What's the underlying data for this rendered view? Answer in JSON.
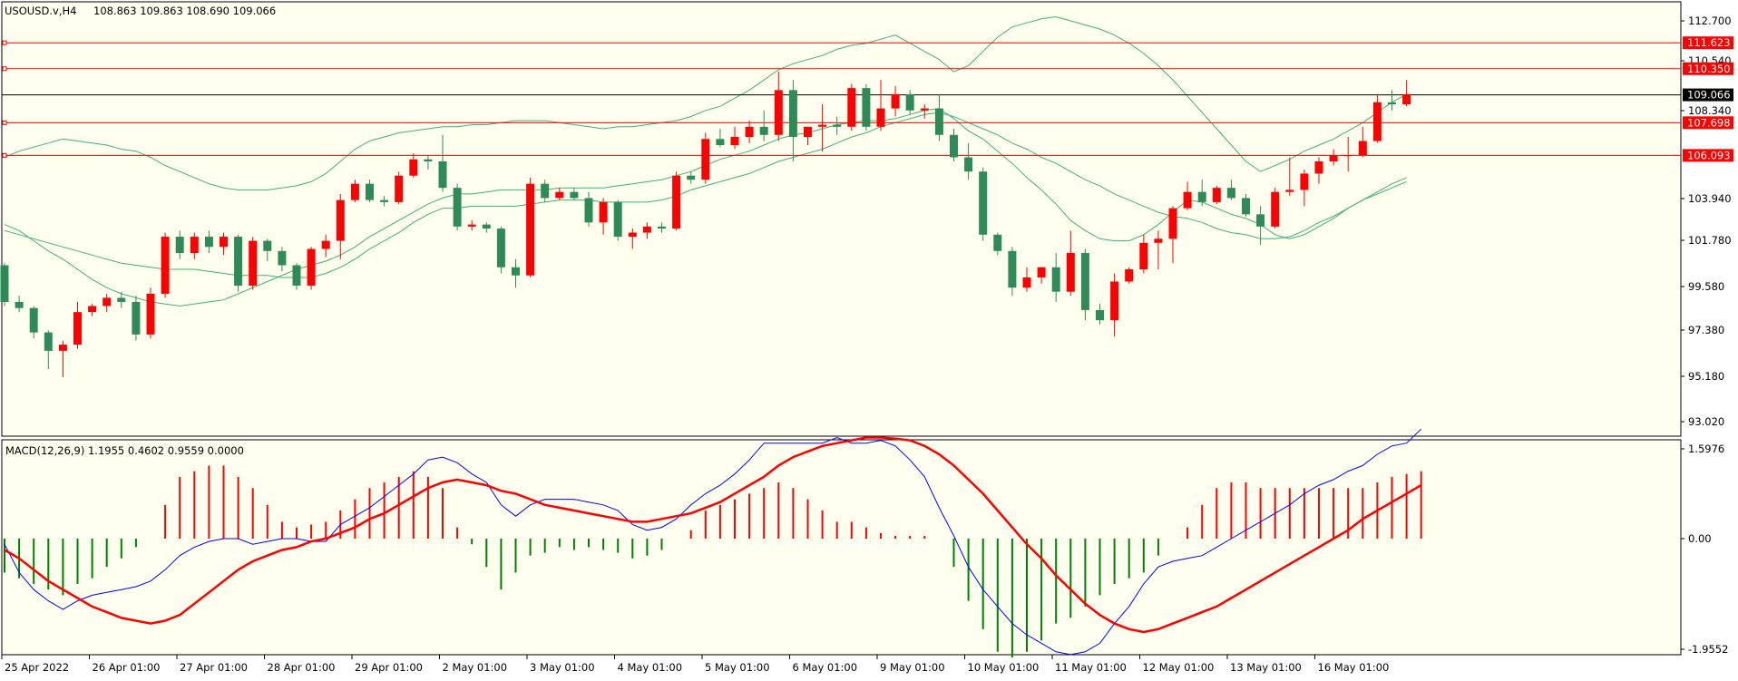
{
  "chart_data": [
    {
      "type": "candlestick",
      "header": {
        "symbol": "USOUSD.v,H4",
        "ohlc": "108.863 109.863 108.690 109.066"
      },
      "ylim": [
        92.0,
        114.0
      ],
      "y_ticks": [
        "112.700",
        "110.540",
        "108.340",
        "103.940",
        "101.780",
        "99.580",
        "97.380",
        "95.180",
        "93.020"
      ],
      "x_ticks": [
        "25 Apr 2022",
        "26 Apr 01:00",
        "27 Apr 01:00",
        "28 Apr 01:00",
        "29 Apr 01:00",
        "2 May 01:00",
        "3 May 01:00",
        "4 May 01:00",
        "5 May 01:00",
        "6 May 01:00",
        "9 May 01:00",
        "10 May 01:00",
        "11 May 01:00",
        "12 May 01:00",
        "13 May 01:00",
        "16 May 01:00"
      ],
      "horizontal_levels": [
        {
          "label": "111.623",
          "value": 111.623,
          "color": "#ff0000"
        },
        {
          "label": "110.350",
          "value": 110.35,
          "color": "#ff0000"
        },
        {
          "label": "107.698",
          "value": 107.698,
          "color": "#ff0000"
        },
        {
          "label": "106.093",
          "value": 106.093,
          "color": "#ff0000"
        }
      ],
      "current_price": {
        "label": "109.066",
        "value": 109.066
      },
      "colors": {
        "up": "#ff0000",
        "down": "#2e8b57",
        "bands": "#3cb371"
      },
      "candles": [
        [
          100.7,
          100.8,
          98.7,
          98.9
        ],
        [
          98.9,
          99.2,
          98.4,
          98.6
        ],
        [
          98.6,
          98.7,
          97.1,
          97.4
        ],
        [
          97.4,
          97.5,
          95.6,
          96.5
        ],
        [
          96.5,
          97.0,
          95.2,
          96.8
        ],
        [
          96.8,
          98.9,
          96.6,
          98.4
        ],
        [
          98.4,
          98.8,
          98.2,
          98.7
        ],
        [
          98.7,
          99.3,
          98.4,
          99.1
        ],
        [
          99.1,
          99.4,
          98.6,
          98.9
        ],
        [
          98.9,
          99.2,
          97.0,
          97.3
        ],
        [
          97.3,
          99.6,
          97.1,
          99.3
        ],
        [
          99.3,
          102.3,
          99.1,
          102.1
        ],
        [
          102.1,
          102.4,
          101.0,
          101.3
        ],
        [
          101.3,
          102.3,
          101.0,
          102.1
        ],
        [
          102.1,
          102.4,
          101.3,
          101.6
        ],
        [
          101.6,
          102.3,
          101.2,
          102.1
        ],
        [
          102.1,
          102.2,
          99.4,
          99.7
        ],
        [
          99.7,
          102.1,
          99.5,
          101.9
        ],
        [
          101.9,
          102.0,
          100.9,
          101.4
        ],
        [
          101.4,
          101.6,
          100.4,
          100.7
        ],
        [
          100.7,
          100.8,
          99.5,
          99.7
        ],
        [
          99.7,
          101.6,
          99.5,
          101.5
        ],
        [
          101.5,
          102.2,
          101.1,
          101.9
        ],
        [
          101.9,
          104.2,
          101.0,
          103.9
        ],
        [
          103.9,
          104.9,
          103.8,
          104.7
        ],
        [
          104.7,
          104.9,
          103.8,
          103.9
        ],
        [
          103.9,
          104.1,
          103.6,
          103.8
        ],
        [
          103.8,
          105.3,
          103.7,
          105.1
        ],
        [
          105.1,
          106.2,
          105.0,
          105.9
        ],
        [
          105.9,
          106.1,
          105.4,
          105.8
        ],
        [
          105.8,
          107.1,
          104.3,
          104.5
        ],
        [
          104.5,
          104.7,
          102.4,
          102.6
        ],
        [
          102.6,
          102.9,
          102.4,
          102.7
        ],
        [
          102.7,
          102.8,
          102.3,
          102.5
        ],
        [
          102.5,
          102.6,
          100.3,
          100.6
        ],
        [
          100.6,
          101.0,
          99.6,
          100.2
        ],
        [
          100.2,
          105.0,
          100.1,
          104.7
        ],
        [
          104.7,
          104.9,
          103.8,
          104.0
        ],
        [
          104.0,
          104.5,
          103.9,
          104.3
        ],
        [
          104.3,
          104.5,
          103.9,
          104.0
        ],
        [
          104.0,
          104.3,
          102.6,
          102.8
        ],
        [
          102.8,
          104.0,
          102.2,
          103.8
        ],
        [
          103.8,
          103.9,
          101.9,
          102.1
        ],
        [
          102.1,
          102.5,
          101.5,
          102.3
        ],
        [
          102.3,
          102.8,
          102.0,
          102.6
        ],
        [
          102.6,
          102.8,
          102.3,
          102.5
        ],
        [
          102.5,
          105.3,
          102.4,
          105.1
        ],
        [
          105.1,
          105.3,
          104.7,
          104.9
        ],
        [
          104.9,
          107.2,
          104.7,
          106.9
        ],
        [
          106.9,
          107.4,
          106.5,
          106.6
        ],
        [
          106.6,
          107.5,
          106.4,
          107.0
        ],
        [
          107.0,
          107.8,
          106.7,
          107.5
        ],
        [
          107.5,
          108.3,
          106.8,
          107.1
        ],
        [
          107.1,
          110.2,
          106.8,
          109.3
        ],
        [
          109.3,
          109.8,
          105.8,
          107.0
        ],
        [
          107.0,
          107.5,
          106.6,
          107.5
        ],
        [
          107.5,
          108.6,
          106.3,
          107.6
        ],
        [
          107.6,
          108.0,
          107.1,
          107.5
        ],
        [
          107.5,
          109.6,
          107.3,
          109.4
        ],
        [
          109.4,
          109.6,
          107.3,
          107.5
        ],
        [
          107.5,
          109.8,
          107.3,
          108.4
        ],
        [
          108.4,
          109.5,
          108.0,
          109.1
        ],
        [
          109.1,
          109.3,
          108.1,
          108.3
        ],
        [
          108.3,
          108.6,
          107.9,
          108.4
        ],
        [
          108.4,
          109.1,
          106.8,
          107.1
        ],
        [
          107.1,
          107.4,
          105.8,
          106.0
        ],
        [
          106.0,
          106.7,
          104.9,
          105.3
        ],
        [
          105.3,
          105.5,
          101.9,
          102.2
        ],
        [
          102.2,
          102.3,
          101.2,
          101.4
        ],
        [
          101.4,
          101.6,
          99.2,
          99.6
        ],
        [
          99.6,
          100.6,
          99.4,
          100.1
        ],
        [
          100.1,
          100.6,
          99.8,
          100.6
        ],
        [
          100.6,
          101.3,
          98.9,
          99.4
        ],
        [
          99.4,
          102.4,
          99.2,
          101.3
        ],
        [
          101.3,
          101.5,
          98.0,
          98.5
        ],
        [
          98.5,
          98.8,
          97.8,
          98.0
        ],
        [
          98.0,
          100.3,
          97.2,
          99.9
        ],
        [
          99.9,
          100.6,
          99.8,
          100.5
        ],
        [
          100.5,
          102.2,
          100.3,
          101.8
        ],
        [
          101.8,
          102.4,
          100.5,
          102.0
        ],
        [
          102.0,
          103.6,
          100.8,
          103.5
        ],
        [
          103.5,
          104.8,
          103.4,
          104.3
        ],
        [
          104.3,
          104.9,
          103.6,
          103.8
        ],
        [
          103.8,
          104.6,
          103.7,
          104.5
        ],
        [
          104.5,
          104.9,
          103.9,
          104.0
        ],
        [
          104.0,
          104.2,
          103.1,
          103.2
        ],
        [
          103.2,
          103.6,
          101.7,
          102.6
        ],
        [
          102.6,
          104.5,
          102.5,
          104.3
        ],
        [
          104.3,
          106.0,
          104.1,
          104.4
        ],
        [
          104.4,
          105.4,
          103.6,
          105.2
        ],
        [
          105.2,
          106.0,
          104.7,
          105.8
        ],
        [
          105.8,
          106.4,
          105.6,
          106.1
        ],
        [
          106.1,
          107.0,
          105.3,
          106.1
        ],
        [
          106.1,
          107.5,
          106.0,
          106.8
        ],
        [
          106.8,
          109.1,
          106.7,
          108.7
        ],
        [
          108.7,
          109.3,
          108.3,
          108.6
        ],
        [
          108.6,
          109.8,
          108.5,
          109.1
        ]
      ],
      "bollinger": {
        "middle": [
          102.4,
          102.2,
          102.0,
          101.8,
          101.6,
          101.4,
          101.2,
          101.0,
          100.8,
          100.7,
          100.6,
          100.5,
          100.5,
          100.5,
          100.4,
          100.3,
          100.2,
          100.2,
          100.2,
          100.1,
          100.1,
          100.1,
          100.3,
          100.6,
          101.0,
          101.5,
          101.9,
          102.3,
          102.8,
          103.2,
          103.5,
          103.5,
          103.6,
          103.6,
          103.6,
          103.6,
          103.7,
          103.8,
          103.9,
          103.9,
          103.9,
          103.8,
          103.8,
          103.8,
          103.8,
          103.9,
          104.1,
          104.4,
          104.6,
          104.8,
          105.0,
          105.2,
          105.5,
          105.8,
          106.0,
          106.2,
          106.4,
          106.7,
          107.0,
          107.2,
          107.5,
          107.7,
          107.9,
          108.1,
          108.2,
          108.0,
          107.7,
          107.4,
          107.1,
          106.7,
          106.4,
          106.0,
          105.7,
          105.3,
          104.9,
          104.6,
          104.2,
          103.9,
          103.6,
          103.3,
          103.1,
          103.0,
          102.8,
          102.5,
          102.3,
          102.2,
          102.0,
          102.0,
          102.1,
          102.4,
          102.8,
          103.1,
          103.5,
          103.9,
          104.2,
          104.5,
          104.8
        ],
        "upper": [
          106.0,
          106.3,
          106.5,
          106.7,
          106.9,
          106.8,
          106.7,
          106.6,
          106.4,
          106.3,
          106.0,
          105.6,
          105.3,
          105.0,
          104.7,
          104.5,
          104.4,
          104.4,
          104.4,
          104.5,
          104.6,
          104.8,
          105.2,
          105.8,
          106.4,
          106.8,
          107.0,
          107.2,
          107.3,
          107.4,
          107.5,
          107.5,
          107.6,
          107.6,
          107.7,
          107.8,
          107.8,
          107.8,
          107.7,
          107.6,
          107.5,
          107.4,
          107.5,
          107.5,
          107.6,
          107.7,
          107.8,
          108.0,
          108.3,
          108.5,
          108.9,
          109.3,
          109.8,
          110.3,
          110.6,
          110.8,
          111.0,
          111.3,
          111.5,
          111.6,
          111.8,
          112.0,
          111.6,
          111.2,
          110.8,
          110.2,
          110.5,
          111.2,
          111.9,
          112.4,
          112.6,
          112.8,
          112.9,
          112.7,
          112.5,
          112.3,
          112.0,
          111.6,
          111.1,
          110.5,
          109.8,
          109.0,
          108.2,
          107.4,
          106.6,
          105.8,
          105.3,
          105.6,
          105.9,
          106.3,
          106.6,
          106.9,
          107.3,
          107.7,
          108.2,
          108.7,
          109.1
        ],
        "lower": [
          102.7,
          102.4,
          101.9,
          101.4,
          101.0,
          100.5,
          100.0,
          99.6,
          99.3,
          99.1,
          98.9,
          98.8,
          98.7,
          98.8,
          98.9,
          99.0,
          99.3,
          99.6,
          99.9,
          100.2,
          100.5,
          100.7,
          100.9,
          101.2,
          101.6,
          102.1,
          102.5,
          102.9,
          103.3,
          103.7,
          104.0,
          104.2,
          104.2,
          104.3,
          104.4,
          104.4,
          104.4,
          104.4,
          104.5,
          104.5,
          104.5,
          104.5,
          104.6,
          104.7,
          104.8,
          104.9,
          105.1,
          105.3,
          105.6,
          105.9,
          106.1,
          106.3,
          106.6,
          106.9,
          107.1,
          107.2,
          107.4,
          107.6,
          107.7,
          107.8,
          107.8,
          107.9,
          108.1,
          108.3,
          108.4,
          107.9,
          107.3,
          106.9,
          106.3,
          105.7,
          105.0,
          104.4,
          103.7,
          102.9,
          102.4,
          102.0,
          101.9,
          101.9,
          102.2,
          102.7,
          103.3,
          103.9,
          103.8,
          103.5,
          103.2,
          103.0,
          102.7,
          102.2,
          102.0,
          102.2,
          102.6,
          103.0,
          103.5,
          103.9,
          104.3,
          104.7,
          105.0
        ]
      }
    },
    {
      "type": "histogram+line",
      "title": "MACD(12,26,9) 1.1955 0.4602 0.9559 0.0000",
      "ylim": [
        -1.9552,
        1.5976
      ],
      "y_ticks": [
        "1.5976",
        "0.00",
        "-1.9552"
      ],
      "colors": {
        "histogram_up": "#ff0000",
        "histogram_down": "#008000",
        "macd_line": "#0000ff",
        "signal_line": "#ff0000"
      },
      "histogram": [
        -0.6,
        -0.7,
        -0.8,
        -0.9,
        -1.0,
        -0.8,
        -0.7,
        -0.5,
        -0.35,
        -0.15,
        0.0,
        0.6,
        1.1,
        1.2,
        1.3,
        1.3,
        1.1,
        0.9,
        0.6,
        0.3,
        0.2,
        0.25,
        0.3,
        0.5,
        0.7,
        0.9,
        1.0,
        1.1,
        1.2,
        1.1,
        0.9,
        0.2,
        -0.1,
        -0.5,
        -0.9,
        -0.6,
        -0.3,
        -0.25,
        -0.15,
        -0.2,
        -0.15,
        -0.2,
        -0.25,
        -0.35,
        -0.3,
        -0.2,
        0.0,
        0.15,
        0.5,
        0.6,
        0.7,
        0.8,
        0.9,
        1.0,
        0.9,
        0.7,
        0.5,
        0.3,
        0.3,
        0.2,
        0.1,
        0.05,
        0.05,
        0.05,
        0.0,
        -0.5,
        -1.1,
        -1.6,
        -2.0,
        -2.1,
        -2.0,
        -1.8,
        -1.5,
        -1.4,
        -1.2,
        -1.0,
        -0.8,
        -0.7,
        -0.6,
        -0.3,
        0.0,
        0.2,
        0.6,
        0.9,
        1.0,
        1.0,
        0.9,
        0.9,
        0.9,
        0.9,
        0.9,
        0.9,
        0.9,
        0.9,
        1.0,
        1.1,
        1.15,
        1.2
      ],
      "macd_line": [
        -0.1,
        -0.6,
        -0.9,
        -1.1,
        -1.25,
        -1.1,
        -1.0,
        -0.95,
        -0.9,
        -0.85,
        -0.75,
        -0.55,
        -0.3,
        -0.15,
        -0.05,
        0.0,
        0.0,
        -0.1,
        -0.05,
        0.0,
        0.0,
        -0.05,
        -0.05,
        0.25,
        0.4,
        0.55,
        0.75,
        0.95,
        1.15,
        1.4,
        1.45,
        1.35,
        1.15,
        1.0,
        0.6,
        0.4,
        0.6,
        0.7,
        0.7,
        0.7,
        0.65,
        0.6,
        0.5,
        0.25,
        0.15,
        0.2,
        0.35,
        0.6,
        0.8,
        0.95,
        1.15,
        1.4,
        1.7,
        1.7,
        1.7,
        1.7,
        1.7,
        1.8,
        1.7,
        1.7,
        1.75,
        1.65,
        1.4,
        1.1,
        0.55,
        0.05,
        -0.5,
        -0.9,
        -1.2,
        -1.5,
        -1.7,
        -1.85,
        -2.0,
        -2.05,
        -2.0,
        -1.85,
        -1.5,
        -1.2,
        -0.8,
        -0.5,
        -0.4,
        -0.35,
        -0.3,
        -0.15,
        0.0,
        0.15,
        0.3,
        0.45,
        0.6,
        0.8,
        0.95,
        1.05,
        1.2,
        1.3,
        1.5,
        1.65,
        1.7,
        1.95
      ],
      "signal_line": [
        -0.2,
        -0.35,
        -0.55,
        -0.75,
        -0.9,
        -1.05,
        -1.2,
        -1.3,
        -1.4,
        -1.45,
        -1.5,
        -1.45,
        -1.35,
        -1.15,
        -0.95,
        -0.75,
        -0.55,
        -0.4,
        -0.3,
        -0.2,
        -0.15,
        -0.05,
        0.0,
        0.1,
        0.2,
        0.35,
        0.45,
        0.6,
        0.75,
        0.9,
        1.0,
        1.05,
        1.0,
        0.95,
        0.85,
        0.8,
        0.7,
        0.6,
        0.55,
        0.5,
        0.45,
        0.4,
        0.35,
        0.3,
        0.3,
        0.35,
        0.4,
        0.45,
        0.55,
        0.65,
        0.8,
        0.95,
        1.1,
        1.3,
        1.45,
        1.55,
        1.65,
        1.7,
        1.75,
        1.8,
        1.8,
        1.78,
        1.75,
        1.65,
        1.5,
        1.3,
        1.05,
        0.8,
        0.5,
        0.2,
        -0.1,
        -0.35,
        -0.65,
        -0.9,
        -1.15,
        -1.35,
        -1.5,
        -1.6,
        -1.65,
        -1.6,
        -1.5,
        -1.4,
        -1.3,
        -1.2,
        -1.05,
        -0.9,
        -0.75,
        -0.6,
        -0.45,
        -0.3,
        -0.15,
        0.0,
        0.15,
        0.35,
        0.5,
        0.65,
        0.8,
        0.95
      ]
    }
  ]
}
